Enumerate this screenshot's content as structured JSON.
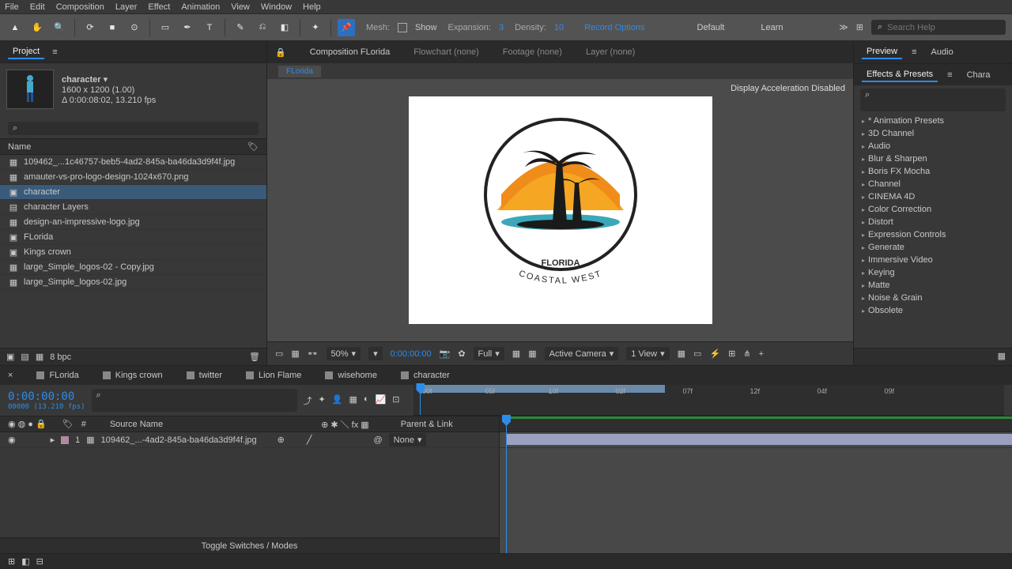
{
  "menu": [
    "File",
    "Edit",
    "Composition",
    "Layer",
    "Effect",
    "Animation",
    "View",
    "Window",
    "Help"
  ],
  "toolbar": {
    "mesh": "Mesh:",
    "show": "Show",
    "expansion_lbl": "Expansion:",
    "expansion_val": "3",
    "density_lbl": "Density:",
    "density_val": "10",
    "record": "Record Options",
    "default": "Default",
    "learn": "Learn",
    "search_placeholder": "Search Help"
  },
  "project": {
    "tab": "Project",
    "comp_name": "character",
    "dims": "1600 x 1200 (1.00)",
    "duration": "Δ 0:00:08:02, 13.210 fps",
    "name_col": "Name",
    "files": [
      {
        "icon": "img",
        "name": "109462_...1c46757-beb5-4ad2-845a-ba46da3d9f4f.jpg"
      },
      {
        "icon": "img",
        "name": "amauter-vs-pro-logo-design-1024x670.png"
      },
      {
        "icon": "comp",
        "name": "character",
        "selected": true
      },
      {
        "icon": "folder",
        "name": "character Layers"
      },
      {
        "icon": "img",
        "name": "design-an-impressive-logo.jpg"
      },
      {
        "icon": "comp",
        "name": "FLorida"
      },
      {
        "icon": "comp",
        "name": "Kings crown"
      },
      {
        "icon": "img",
        "name": "large_Simple_logos-02 - Copy.jpg"
      },
      {
        "icon": "img",
        "name": "large_Simple_logos-02.jpg"
      }
    ],
    "footer_bpc": "8 bpc"
  },
  "center": {
    "tabs": [
      {
        "label": "Composition FLorida",
        "active": true,
        "prefix": "Composition "
      },
      {
        "label": "Flowchart (none)"
      },
      {
        "label": "Footage (none)"
      },
      {
        "label": "Layer (none)"
      }
    ],
    "subtab": "FLorida",
    "disp_accel": "Display Acceleration Disabled",
    "zoom": "50%",
    "time": "0:00:00:00",
    "full": "Full",
    "camera": "Active Camera",
    "view": "1 View",
    "logo_main": "FLORIDA",
    "logo_sub": "COASTAL WEST"
  },
  "right": {
    "preview": "Preview",
    "audio": "Audio",
    "effects_presets": "Effects & Presets",
    "chars": "Chara",
    "categories": [
      "* Animation Presets",
      "3D Channel",
      "Audio",
      "Blur & Sharpen",
      "Boris FX Mocha",
      "Channel",
      "CINEMA 4D",
      "Color Correction",
      "Distort",
      "Expression Controls",
      "Generate",
      "Immersive Video",
      "Keying",
      "Matte",
      "Noise & Grain",
      "Obsolete"
    ]
  },
  "timeline": {
    "tabs": [
      "FLorida",
      "Kings crown",
      "twitter",
      "Lion Flame",
      "wisehome",
      "character"
    ],
    "timecode": "0:00:00:00",
    "timecode_sub": "00000 (13.210 fps)",
    "cols": {
      "num": "#",
      "source": "Source Name",
      "parent": "Parent & Link"
    },
    "layer": {
      "num": "1",
      "name": "109462_...-4ad2-845a-ba46da3d9f4f.jpg",
      "parent": "None"
    },
    "ruler": [
      ":00f",
      "05f",
      "10f",
      "02f",
      "07f",
      "12f",
      "04f",
      "09f"
    ],
    "toggle": "Toggle Switches / Modes"
  }
}
